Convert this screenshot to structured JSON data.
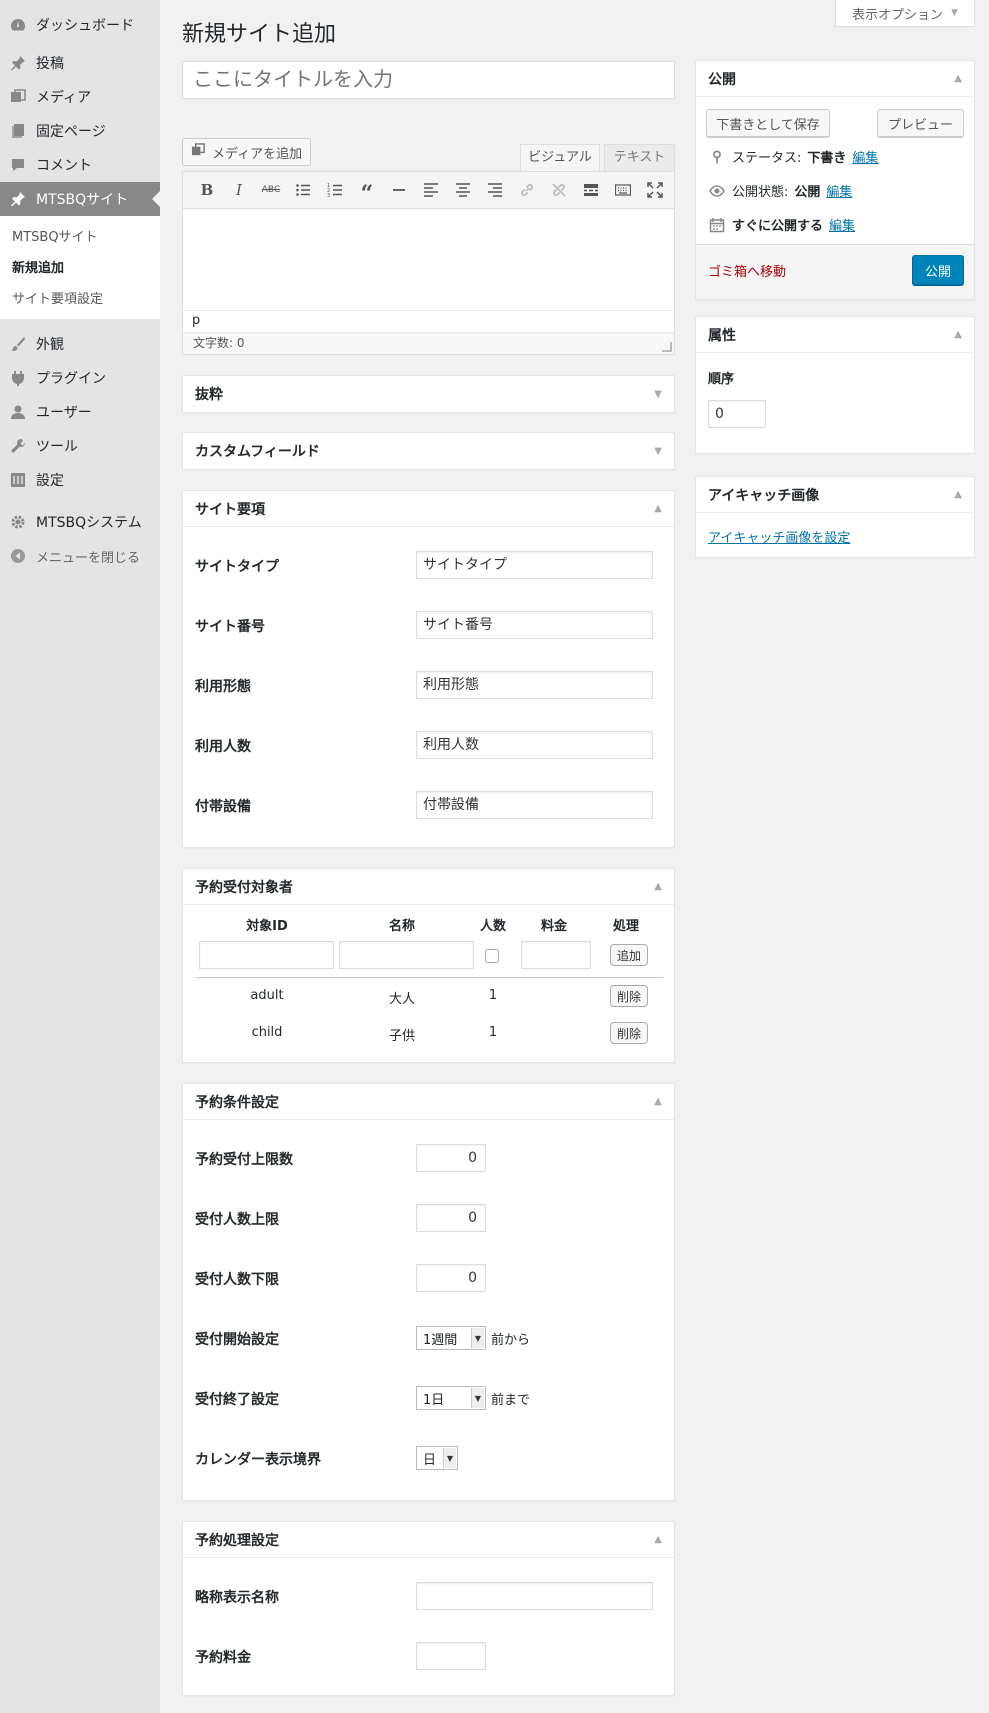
{
  "screen_options": "表示オプション",
  "page_title": "新規サイト追加",
  "title_placeholder": "ここにタイトルを入力",
  "sidebar": {
    "items": [
      {
        "label": "ダッシュボード",
        "icon": "dashboard-icon"
      },
      {
        "label": "投稿",
        "icon": "pin-icon"
      },
      {
        "label": "メディア",
        "icon": "media-icon"
      },
      {
        "label": "固定ページ",
        "icon": "page-icon"
      },
      {
        "label": "コメント",
        "icon": "comment-icon"
      },
      {
        "label": "MTSBQサイト",
        "icon": "pin-icon"
      }
    ],
    "submenu": [
      "MTSBQサイト",
      "新規追加",
      "サイト要項設定"
    ],
    "items2": [
      {
        "label": "外観",
        "icon": "brush-icon"
      },
      {
        "label": "プラグイン",
        "icon": "plugin-icon"
      },
      {
        "label": "ユーザー",
        "icon": "user-icon"
      },
      {
        "label": "ツール",
        "icon": "wrench-icon"
      },
      {
        "label": "設定",
        "icon": "settings-icon"
      },
      {
        "label": "MTSBQシステム",
        "icon": "gear-icon"
      }
    ],
    "collapse": "メニューを閉じる"
  },
  "editor": {
    "add_media": "メディアを追加",
    "tab_visual": "ビジュアル",
    "tab_text": "テキスト",
    "path": "p",
    "word_count": "文字数: 0"
  },
  "excerpt": {
    "title": "抜粋"
  },
  "custom_fields": {
    "title": "カスタムフィールド"
  },
  "site_details": {
    "title": "サイト要項",
    "fields": [
      {
        "label": "サイトタイプ",
        "value": "サイトタイプ"
      },
      {
        "label": "サイト番号",
        "value": "サイト番号"
      },
      {
        "label": "利用形態",
        "value": "利用形態"
      },
      {
        "label": "利用人数",
        "value": "利用人数"
      },
      {
        "label": "付帯設備",
        "value": "付帯設備"
      }
    ]
  },
  "reservation_targets": {
    "title": "予約受付対象者",
    "headers": [
      "対象ID",
      "名称",
      "人数",
      "料金",
      "処理"
    ],
    "add_button": "追加",
    "rows": [
      {
        "id": "adult",
        "name": "大人",
        "count": "1",
        "fee": "",
        "action": "削除"
      },
      {
        "id": "child",
        "name": "子供",
        "count": "1",
        "fee": "",
        "action": "削除"
      }
    ]
  },
  "reservation_conditions": {
    "title": "予約条件設定",
    "max_reservations": {
      "label": "予約受付上限数",
      "value": "0"
    },
    "max_people": {
      "label": "受付人数上限",
      "value": "0"
    },
    "min_people": {
      "label": "受付人数下限",
      "value": "0"
    },
    "start": {
      "label": "受付開始設定",
      "value": "1週間",
      "suffix": "前から"
    },
    "end": {
      "label": "受付終了設定",
      "value": "1日",
      "suffix": "前まで"
    },
    "calendar": {
      "label": "カレンダー表示境界",
      "value": "日"
    }
  },
  "reservation_processing": {
    "title": "予約処理設定",
    "short_name": {
      "label": "略称表示名称",
      "value": ""
    },
    "fee": {
      "label": "予約料金",
      "value": ""
    }
  },
  "publish": {
    "title": "公開",
    "save_draft": "下書きとして保存",
    "preview": "プレビュー",
    "status_label": "ステータス:",
    "status_value": "下書き",
    "visibility_label": "公開状態:",
    "visibility_value": "公開",
    "schedule_label": "すぐに公開する",
    "edit": "編集",
    "trash": "ゴミ箱へ移動",
    "publish_button": "公開"
  },
  "attributes": {
    "title": "属性",
    "order_label": "順序",
    "order_value": "0"
  },
  "featured_image": {
    "title": "アイキャッチ画像",
    "set_link": "アイキャッチ画像を設定"
  },
  "colors": {
    "primary": "#0085ba",
    "link": "#0073aa",
    "danger": "#a00000",
    "sidebar_bg": "#e4e4e4",
    "sidebar_active": "#888888"
  }
}
